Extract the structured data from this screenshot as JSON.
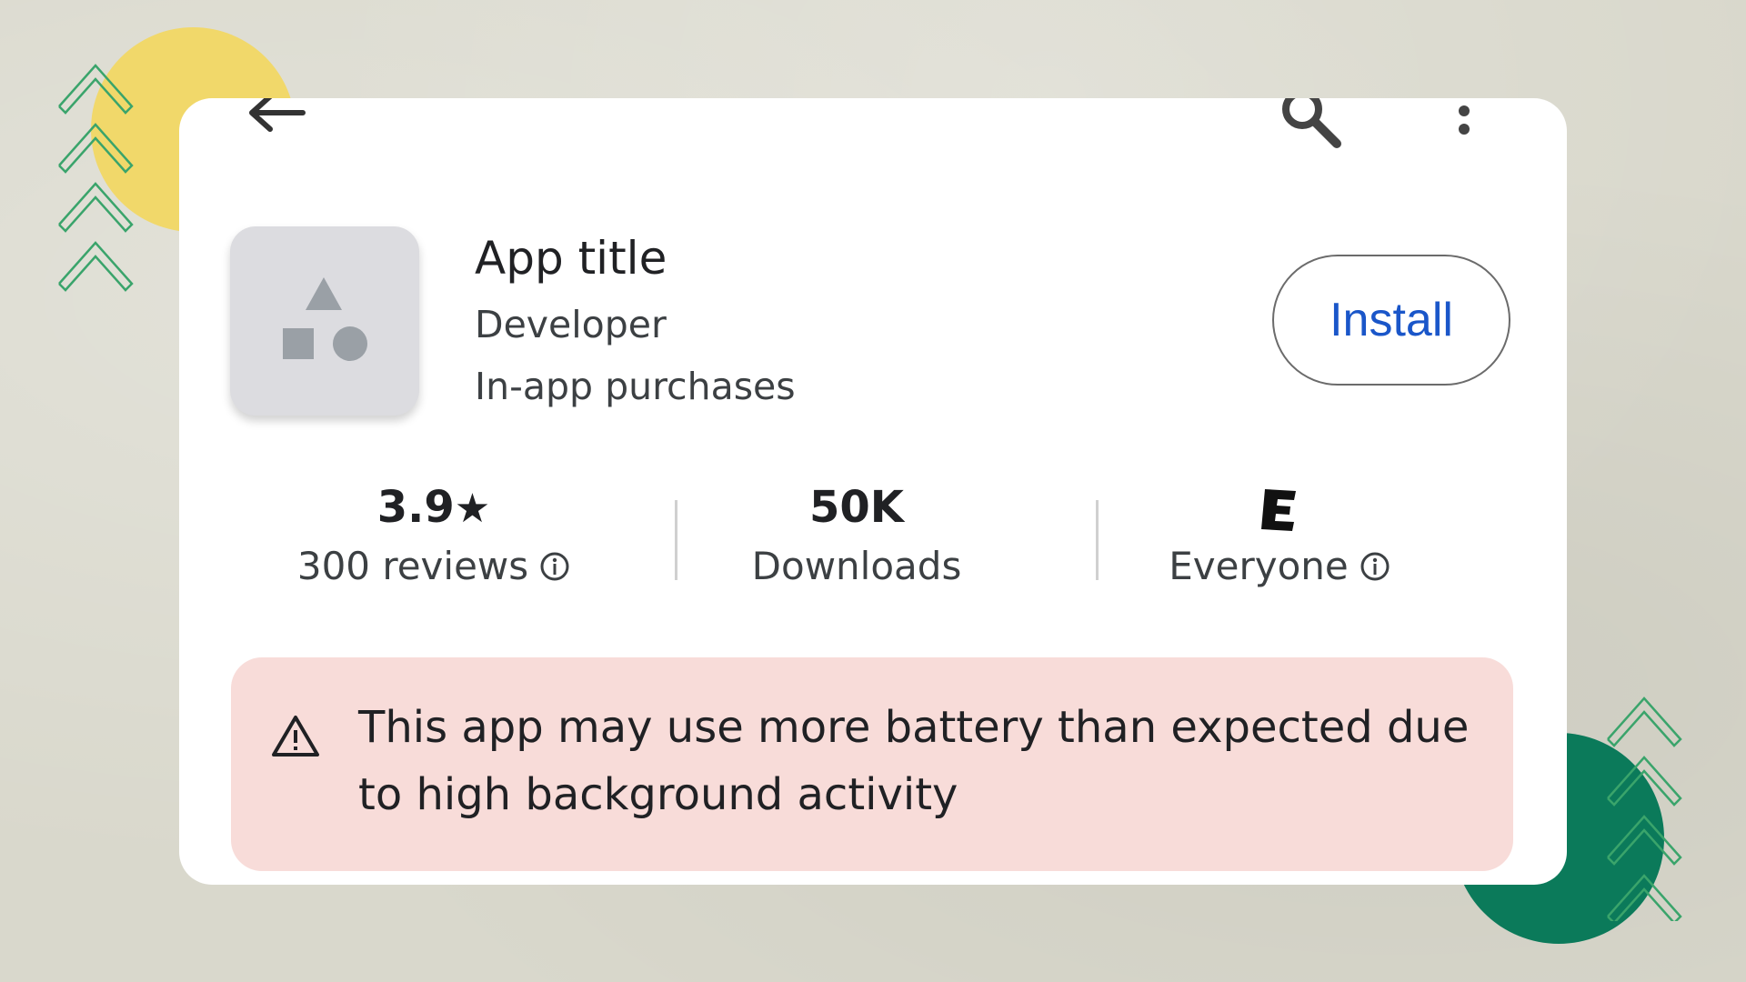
{
  "app": {
    "title": "App title",
    "developer": "Developer",
    "purchase_info": "In-app purchases",
    "install_label": "Install"
  },
  "stats": {
    "rating": "3.9",
    "rating_star": "★",
    "reviews": "300 reviews",
    "downloads": "50K",
    "downloads_label": "Downloads",
    "content_rating_label": "Everyone"
  },
  "warning": {
    "text": "This app may use more battery than expected due to high background activity"
  },
  "colors": {
    "install_text": "#1a56c9",
    "warning_bg": "#f8dcd9",
    "deco_yellow": "#f1d86a",
    "deco_teal": "#0b7a5a",
    "deco_chevron": "#3aa46b"
  },
  "icons": [
    "back-arrow-icon",
    "search-icon",
    "more-vert-icon",
    "app-placeholder-icon",
    "star-icon",
    "info-icon",
    "esrb-everyone-icon",
    "warning-icon"
  ]
}
